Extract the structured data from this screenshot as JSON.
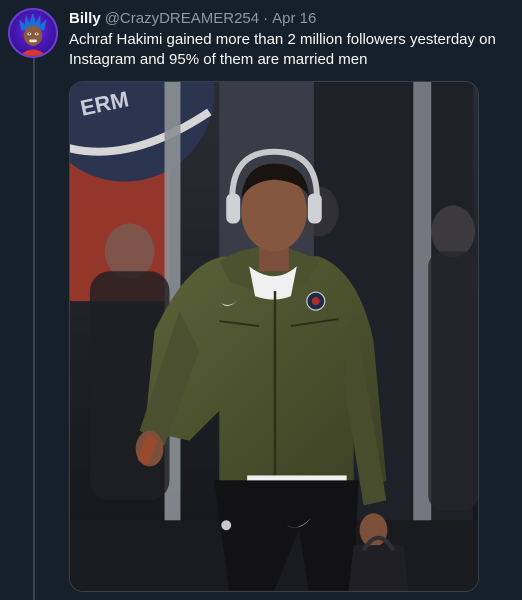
{
  "tweet": {
    "display_name": "Billy",
    "handle": "@CrazyDREAMER254",
    "separator": "·",
    "date": "Apr 16",
    "text": "Achraf Hakimi gained more than 2 million followers yesterday on Instagram and 95% of them are married men"
  },
  "media": {
    "background_sign_text": "ERM"
  },
  "colors": {
    "background": "#15202b",
    "text_primary": "#f7f9f9",
    "text_secondary": "#8b98a5",
    "border": "#38444d"
  },
  "icons": {
    "avatar": "profile-avatar",
    "psg_crest": "psg-crest-icon",
    "nike_swoosh": "nike-swoosh-icon"
  }
}
